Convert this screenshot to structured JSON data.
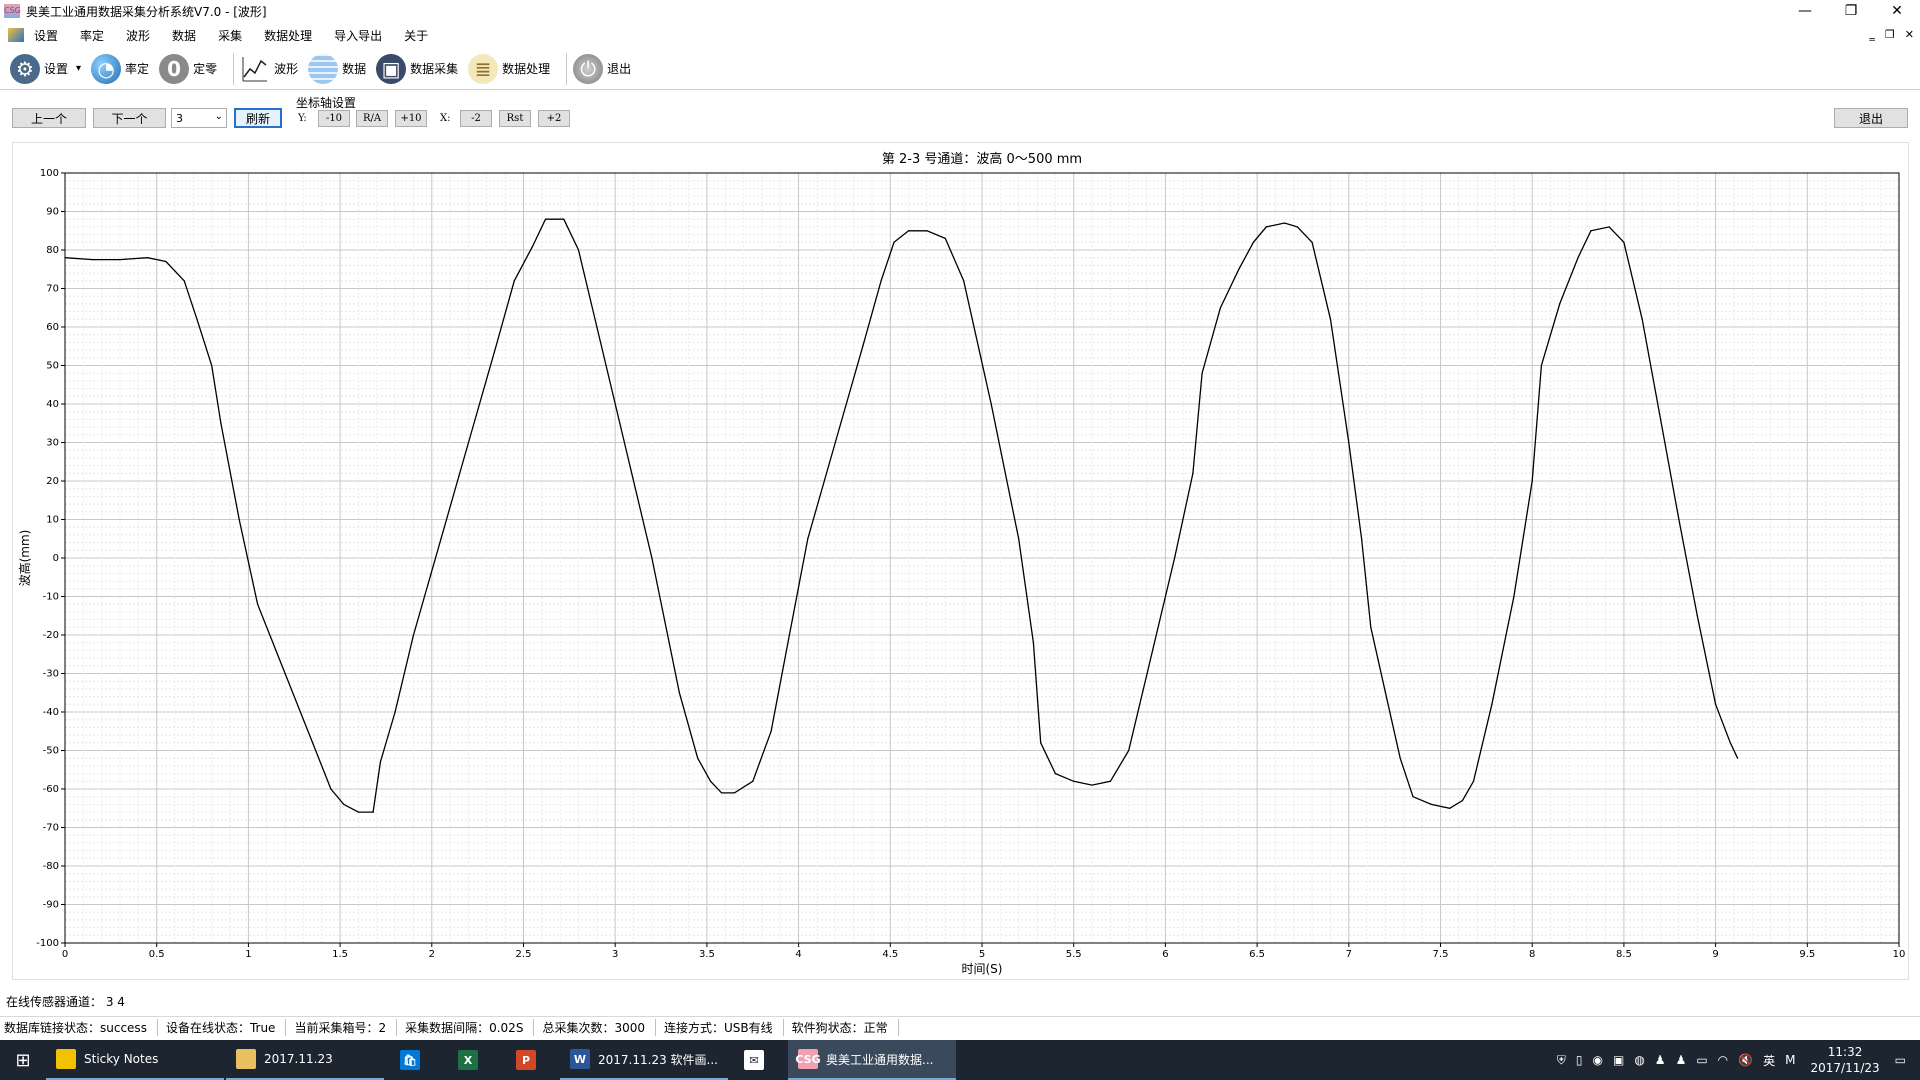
{
  "window": {
    "title": "奥美工业通用数据采集分析系统V7.0 - [波形]",
    "app_icon": "app-logo-icon",
    "controls": [
      "—",
      "❐",
      "✕"
    ]
  },
  "menubar": {
    "items": [
      "设置",
      "率定",
      "波形",
      "数据",
      "采集",
      "数据处理",
      "导入导出",
      "关于"
    ],
    "mdi_controls": [
      "‗",
      "❐",
      "✕"
    ]
  },
  "toolbar": {
    "items": [
      {
        "label": "设置",
        "icon": "gear-icon",
        "glyph": "⚙"
      },
      {
        "label": "率定",
        "icon": "globe-icon",
        "glyph": "◔"
      },
      {
        "label": "定零",
        "icon": "zero-icon",
        "glyph": "0"
      },
      {
        "label": "波形",
        "icon": "waveform-icon",
        "glyph": "📈"
      },
      {
        "label": "数据",
        "icon": "table-icon",
        "glyph": ""
      },
      {
        "label": "数据采集",
        "icon": "save-disk-icon",
        "glyph": "💾"
      },
      {
        "label": "数据处理",
        "icon": "clipboard-icon",
        "glyph": "📋"
      },
      {
        "label": "退出",
        "icon": "power-icon",
        "glyph": "⏻"
      }
    ],
    "dropdown_arrow": "▾"
  },
  "controls": {
    "prev_label": "上一个",
    "next_label": "下一个",
    "channel_value": "3",
    "refresh_label": "刷新",
    "axis_group_label": "坐标轴设置",
    "y_label": "Y:",
    "y_minus": "-10",
    "y_auto": "R/A",
    "y_plus": "+10",
    "x_label": "X:",
    "x_minus": "-2",
    "x_reset": "Rst",
    "x_plus": "+2",
    "exit_label": "退出"
  },
  "chart_data": {
    "type": "line",
    "title": "第 2-3 号通道：波高 0～500 mm",
    "xlabel": "时间(S)",
    "ylabel": "波高(mm)",
    "xlim": [
      0,
      10
    ],
    "ylim": [
      -100,
      100
    ],
    "x_ticks": [
      0,
      0.5,
      1,
      1.5,
      2,
      2.5,
      3,
      3.5,
      4,
      4.5,
      5,
      5.5,
      6,
      6.5,
      7,
      7.5,
      8,
      8.5,
      9,
      9.5,
      10
    ],
    "y_ticks": [
      100,
      90,
      80,
      70,
      60,
      50,
      40,
      30,
      20,
      10,
      0,
      -10,
      -20,
      -30,
      -40,
      -50,
      -60,
      -70,
      -80,
      -90,
      -100
    ],
    "grid": true,
    "line_color": "#000000",
    "series": [
      {
        "x": [
          0,
          0.15,
          0.3,
          0.45,
          0.55,
          0.65,
          0.72,
          0.8,
          0.85,
          0.95,
          1.05,
          1.2,
          1.35,
          1.45,
          1.52,
          1.6,
          1.68,
          1.72,
          1.8,
          1.9,
          2.05,
          2.2,
          2.35,
          2.45,
          2.55,
          2.62,
          2.72,
          2.8,
          2.9,
          3.05,
          3.2,
          3.35,
          3.45,
          3.52,
          3.58,
          3.65,
          3.75,
          3.85,
          3.95,
          4.05,
          4.2,
          4.35,
          4.45,
          4.52,
          4.6,
          4.7,
          4.8,
          4.9,
          5.05,
          5.2,
          5.28,
          5.32,
          5.4,
          5.5,
          5.6,
          5.7,
          5.8,
          5.9,
          6.05,
          6.15,
          6.2,
          6.3,
          6.4,
          6.48,
          6.55,
          6.65,
          6.72,
          6.8,
          6.9,
          7.0,
          7.07,
          7.12,
          7.2,
          7.28,
          7.35,
          7.45,
          7.55,
          7.62,
          7.68,
          7.78,
          7.9,
          8.0,
          8.05,
          8.15,
          8.25,
          8.32,
          8.42,
          8.5,
          8.6,
          8.7,
          8.8,
          8.9,
          9.0,
          9.08,
          9.12
        ],
        "y": [
          78,
          77.5,
          77.5,
          78,
          77,
          72,
          62,
          50,
          35,
          10,
          -12,
          -30,
          -48,
          -60,
          -64,
          -66,
          -66,
          -53,
          -40,
          -20,
          5,
          30,
          55,
          72,
          81,
          88,
          88,
          80,
          60,
          30,
          0,
          -35,
          -52,
          -58,
          -61,
          -61,
          -58,
          -45,
          -20,
          5,
          30,
          55,
          72,
          82,
          85,
          85,
          83,
          72,
          40,
          5,
          -22,
          -48,
          -56,
          -58,
          -59,
          -58,
          -50,
          -30,
          0,
          22,
          48,
          65,
          75,
          82,
          86,
          87,
          86,
          82,
          62,
          30,
          5,
          -18,
          -35,
          -52,
          -62,
          -64,
          -65,
          -63,
          -58,
          -38,
          -10,
          20,
          50,
          66,
          78,
          85,
          86,
          82,
          62,
          36,
          10,
          -15,
          -38,
          -48,
          -52
        ]
      }
    ]
  },
  "status": {
    "online_channels": "在线传感器通道： 3 4",
    "db_link": "数据库链接状态：success",
    "device_online": "设备在线状态：True",
    "current_box": "当前采集箱号：2",
    "interval": "采集数据间隔：0.02S",
    "total_count": "总采集次数：3000",
    "connection": "连接方式：USB有线",
    "dongle": "软件狗状态：正常"
  },
  "taskbar": {
    "start_glyph": "⊞",
    "tasks": [
      {
        "label": "Sticky Notes",
        "icon": "sticky-notes-icon",
        "color": "#f2c200",
        "glyph": ""
      },
      {
        "label": "2017.11.23",
        "icon": "folder-icon",
        "color": "#e8c060",
        "glyph": ""
      },
      {
        "label": "",
        "icon": "store-icon",
        "color": "#0078d7",
        "glyph": "🛍"
      },
      {
        "label": "",
        "icon": "excel-icon",
        "color": "#1e7145",
        "glyph": "X"
      },
      {
        "label": "",
        "icon": "powerpoint-icon",
        "color": "#d24726",
        "glyph": "P"
      },
      {
        "label": "2017.11.23 软件画...",
        "icon": "word-icon",
        "color": "#2b579a",
        "glyph": "W"
      },
      {
        "label": "",
        "icon": "mail-icon",
        "color": "#ffffff",
        "glyph": "✉"
      },
      {
        "label": "奥美工业通用数据...",
        "icon": "app-logo-icon",
        "color": "#f0a0b0",
        "glyph": "CSG"
      }
    ],
    "tray_icons": [
      "shield-icon",
      "usb-icon",
      "chrome-icon",
      "qq-icon",
      "wechat-icon",
      "penguin-icon",
      "penguin-icon",
      "battery-icon",
      "wifi-icon",
      "volume-icon"
    ],
    "tray_glyphs": [
      "⛨",
      "▯",
      "◉",
      "▣",
      "◍",
      "♟",
      "♟",
      "▭",
      "◠",
      "🔇"
    ],
    "ime": "英",
    "ime2": "M",
    "time": "11:32",
    "date": "2017/11/23",
    "notif_glyph": "▭"
  }
}
